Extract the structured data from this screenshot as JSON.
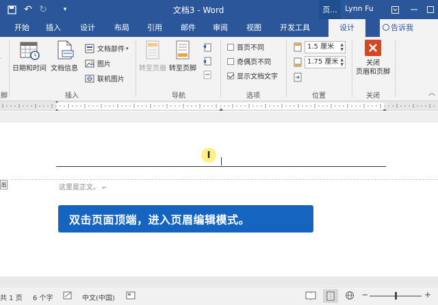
{
  "title_bar": {
    "document_title": "文档3 - Word",
    "context_tab": "页...",
    "user_name": "Lynn Fu",
    "save_icon": "save-icon",
    "undo_icon": "undo-icon",
    "redo_icon": "redo-icon"
  },
  "tabs": [
    {
      "label": "开始"
    },
    {
      "label": "插入"
    },
    {
      "label": "设计"
    },
    {
      "label": "布局"
    },
    {
      "label": "引用"
    },
    {
      "label": "邮件"
    },
    {
      "label": "审阅"
    },
    {
      "label": "视图"
    },
    {
      "label": "开发工具"
    },
    {
      "label": "设计"
    }
  ],
  "tell_me": "告诉我",
  "ribbon": {
    "insert_group": {
      "date_time": "日期和时间",
      "doc_info": "文档信息",
      "doc_parts": "文档部件",
      "picture": "图片",
      "online_picture": "联机图片",
      "label": "插入"
    },
    "nav_group": {
      "goto_header": "转至页眉",
      "goto_footer": "转至页脚",
      "label": "导航"
    },
    "options_group": {
      "first_page_diff": "首页不同",
      "odd_even_diff": "奇偶页不同",
      "show_doc_text": "显示文档文字",
      "label": "选项"
    },
    "position_group": {
      "header_pos": "1.5 厘米",
      "footer_pos": "1.75 厘米",
      "label": "位置"
    },
    "close_group": {
      "close_line1": "关闭",
      "close_line2": "页眉和页脚",
      "label": "关闭"
    },
    "left_partial": "脚"
  },
  "document": {
    "header_tag": "眉",
    "body_text": "这里是正文。",
    "paragraph_mark": "↵",
    "banner_text": "双击页面顶端，进入页眉编辑模式。"
  },
  "status_bar": {
    "page": "共 1 页",
    "words": "6 个字",
    "language": "中文(中国)",
    "zoom_minus": "−",
    "zoom_plus": "+"
  }
}
